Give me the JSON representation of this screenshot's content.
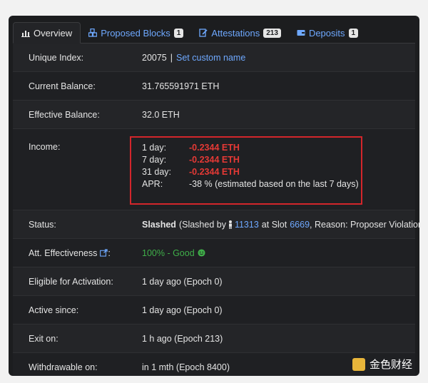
{
  "tabs": [
    {
      "label": "Overview",
      "icon": "chart-icon",
      "badge": null
    },
    {
      "label": "Proposed Blocks",
      "icon": "cubes-icon",
      "badge": "1"
    },
    {
      "label": "Attestations",
      "icon": "attest-icon",
      "badge": "213"
    },
    {
      "label": "Deposits",
      "icon": "wallet-icon",
      "badge": "1"
    }
  ],
  "rows": {
    "unique_index": {
      "label": "Unique Index:",
      "value": "20075",
      "link": "Set custom name"
    },
    "current_balance": {
      "label": "Current Balance:",
      "value": "31.765591971 ETH"
    },
    "effective_balance": {
      "label": "Effective Balance:",
      "value": "32.0 ETH"
    },
    "income": {
      "label": "Income:",
      "d1_k": "1 day:",
      "d1_v": "-0.2344 ETH",
      "d7_k": "7 day:",
      "d7_v": "-0.2344 ETH",
      "d31_k": "31 day:",
      "d31_v": "-0.2344 ETH",
      "apr_k": "APR:",
      "apr_v": "-38 % (estimated based on the last 7 days)"
    },
    "status": {
      "label": "Status:",
      "state": "Slashed",
      "pre": "(Slashed by",
      "by_index": "11313",
      "mid": "at Slot",
      "slot": "6669",
      "post": ", Reason: Proposer Violation)"
    },
    "att_eff": {
      "label": "Att. Effectiveness",
      "value": "100% - Good"
    },
    "eligible": {
      "label": "Eligible for Activation:",
      "value": "1 day ago (Epoch 0)"
    },
    "active": {
      "label": "Active since:",
      "value": "1 day ago (Epoch 0)"
    },
    "exit": {
      "label": "Exit on:",
      "value": "1 h ago (Epoch 213)"
    },
    "withdrawable": {
      "label": "Withdrawable on:",
      "value": "in 1 mth (Epoch 8400)"
    }
  },
  "watermark": "金色财经",
  "colors": {
    "accent": "#6ea8fe",
    "negative": "#e53935",
    "good": "#3fae49",
    "highlight": "#d3262b"
  }
}
